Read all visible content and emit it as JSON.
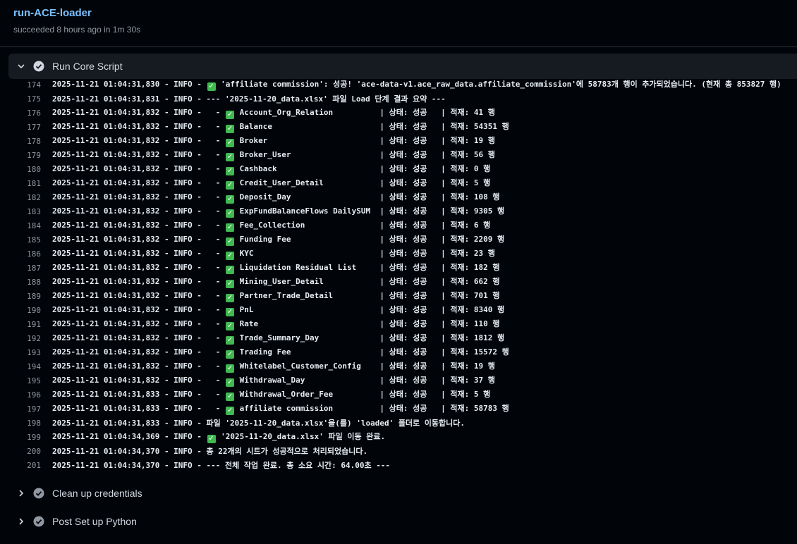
{
  "job": {
    "title": "run-ACE-loader",
    "subtitle": "succeeded 8 hours ago in 1m 30s"
  },
  "steps": [
    {
      "label": "Run Core Script",
      "status": "success",
      "expanded": true
    },
    {
      "label": "Clean up credentials",
      "status": "success",
      "expanded": false
    },
    {
      "label": "Post Set up Python",
      "status": "success",
      "expanded": false
    }
  ],
  "log_lines": [
    {
      "n": "174",
      "pre": "2025-11-21 01:04:31,830 - INFO - ",
      "ok": true,
      "post": " 'affiliate commission': 성공! 'ace-data-v1.ace_raw_data.affiliate_commission'에 58783개 행이 추가되었습니다. (현재 총 853827 행)"
    },
    {
      "n": "175",
      "pre": "2025-11-21 01:04:31,831 - INFO - --- '2025-11-20_data.xlsx' 파일 Load 단계 결과 요약 ---",
      "ok": false,
      "post": ""
    },
    {
      "n": "176",
      "pre": "2025-11-21 01:04:31,832 - INFO -   - ",
      "ok": true,
      "post": " Account_Org_Relation          | 상태: 성공   | 적재: 41 행"
    },
    {
      "n": "177",
      "pre": "2025-11-21 01:04:31,832 - INFO -   - ",
      "ok": true,
      "post": " Balance                       | 상태: 성공   | 적재: 54351 행"
    },
    {
      "n": "178",
      "pre": "2025-11-21 01:04:31,832 - INFO -   - ",
      "ok": true,
      "post": " Broker                        | 상태: 성공   | 적재: 19 행"
    },
    {
      "n": "179",
      "pre": "2025-11-21 01:04:31,832 - INFO -   - ",
      "ok": true,
      "post": " Broker_User                   | 상태: 성공   | 적재: 56 행"
    },
    {
      "n": "180",
      "pre": "2025-11-21 01:04:31,832 - INFO -   - ",
      "ok": true,
      "post": " Cashback                      | 상태: 성공   | 적재: 0 행"
    },
    {
      "n": "181",
      "pre": "2025-11-21 01:04:31,832 - INFO -   - ",
      "ok": true,
      "post": " Credit_User_Detail            | 상태: 성공   | 적재: 5 행"
    },
    {
      "n": "182",
      "pre": "2025-11-21 01:04:31,832 - INFO -   - ",
      "ok": true,
      "post": " Deposit_Day                   | 상태: 성공   | 적재: 108 행"
    },
    {
      "n": "183",
      "pre": "2025-11-21 01:04:31,832 - INFO -   - ",
      "ok": true,
      "post": " ExpFundBalanceFlows DailySUM  | 상태: 성공   | 적재: 9305 행"
    },
    {
      "n": "184",
      "pre": "2025-11-21 01:04:31,832 - INFO -   - ",
      "ok": true,
      "post": " Fee_Collection                | 상태: 성공   | 적재: 6 행"
    },
    {
      "n": "185",
      "pre": "2025-11-21 01:04:31,832 - INFO -   - ",
      "ok": true,
      "post": " Funding Fee                   | 상태: 성공   | 적재: 2209 행"
    },
    {
      "n": "186",
      "pre": "2025-11-21 01:04:31,832 - INFO -   - ",
      "ok": true,
      "post": " KYC                           | 상태: 성공   | 적재: 23 행"
    },
    {
      "n": "187",
      "pre": "2025-11-21 01:04:31,832 - INFO -   - ",
      "ok": true,
      "post": " Liquidation Residual List     | 상태: 성공   | 적재: 182 행"
    },
    {
      "n": "188",
      "pre": "2025-11-21 01:04:31,832 - INFO -   - ",
      "ok": true,
      "post": " Mining_User_Detail            | 상태: 성공   | 적재: 662 행"
    },
    {
      "n": "189",
      "pre": "2025-11-21 01:04:31,832 - INFO -   - ",
      "ok": true,
      "post": " Partner_Trade_Detail          | 상태: 성공   | 적재: 701 행"
    },
    {
      "n": "190",
      "pre": "2025-11-21 01:04:31,832 - INFO -   - ",
      "ok": true,
      "post": " PnL                           | 상태: 성공   | 적재: 8340 행"
    },
    {
      "n": "191",
      "pre": "2025-11-21 01:04:31,832 - INFO -   - ",
      "ok": true,
      "post": " Rate                          | 상태: 성공   | 적재: 110 행"
    },
    {
      "n": "192",
      "pre": "2025-11-21 01:04:31,832 - INFO -   - ",
      "ok": true,
      "post": " Trade_Summary_Day             | 상태: 성공   | 적재: 1812 행"
    },
    {
      "n": "193",
      "pre": "2025-11-21 01:04:31,832 - INFO -   - ",
      "ok": true,
      "post": " Trading Fee                   | 상태: 성공   | 적재: 15572 행"
    },
    {
      "n": "194",
      "pre": "2025-11-21 01:04:31,832 - INFO -   - ",
      "ok": true,
      "post": " Whitelabel_Customer_Config    | 상태: 성공   | 적재: 19 행"
    },
    {
      "n": "195",
      "pre": "2025-11-21 01:04:31,832 - INFO -   - ",
      "ok": true,
      "post": " Withdrawal_Day                | 상태: 성공   | 적재: 37 행"
    },
    {
      "n": "196",
      "pre": "2025-11-21 01:04:31,833 - INFO -   - ",
      "ok": true,
      "post": " Withdrawal_Order_Fee          | 상태: 성공   | 적재: 5 행"
    },
    {
      "n": "197",
      "pre": "2025-11-21 01:04:31,833 - INFO -   - ",
      "ok": true,
      "post": " affiliate commission          | 상태: 성공   | 적재: 58783 행"
    },
    {
      "n": "198",
      "pre": "2025-11-21 01:04:31,833 - INFO - 파일 '2025-11-20_data.xlsx'을(를) 'loaded' 폴더로 이동합니다.",
      "ok": false,
      "post": ""
    },
    {
      "n": "199",
      "pre": "2025-11-21 01:04:34,369 - INFO - ",
      "ok": true,
      "post": " '2025-11-20_data.xlsx' 파일 이동 완료."
    },
    {
      "n": "200",
      "pre": "2025-11-21 01:04:34,370 - INFO - 총 22개의 시트가 성공적으로 처리되었습니다.",
      "ok": false,
      "post": ""
    },
    {
      "n": "201",
      "pre": "2025-11-21 01:04:34,370 - INFO - --- 전체 작업 완료. 총 소요 시간: 64.00초 ---",
      "ok": false,
      "post": ""
    }
  ],
  "colors": {
    "background": "#010409",
    "title": "#79c0ff",
    "success": "#3fb950",
    "step_bg": "#161b22"
  }
}
